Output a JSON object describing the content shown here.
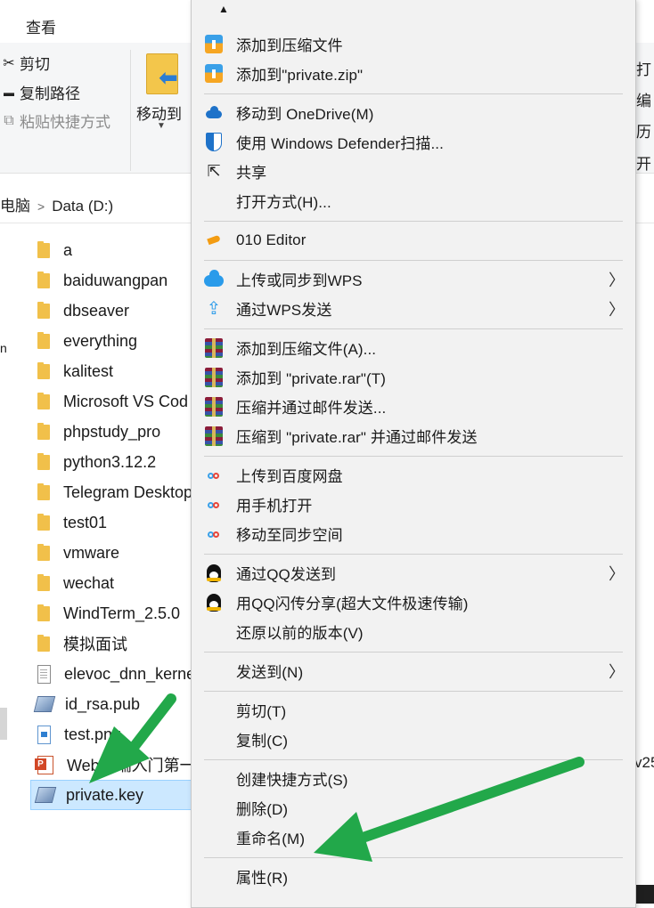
{
  "ribbon": {
    "tab_view": "查看",
    "cut": "剪切",
    "copy_path": "复制路径",
    "paste_shortcut": "粘贴快捷方式",
    "move_to": "移动到",
    "right_fragments": [
      "打",
      "编",
      "历",
      "开"
    ]
  },
  "address": {
    "crumb1": "电脑",
    "crumb2": "Data (D:)"
  },
  "files": [
    {
      "name": "a",
      "type": "folder"
    },
    {
      "name": "baiduwangpan",
      "type": "folder"
    },
    {
      "name": "dbseaver",
      "type": "folder"
    },
    {
      "name": "everything",
      "type": "folder"
    },
    {
      "name": "kalitest",
      "type": "folder"
    },
    {
      "name": "Microsoft VS Cod",
      "type": "folder"
    },
    {
      "name": "phpstudy_pro",
      "type": "folder"
    },
    {
      "name": "python3.12.2",
      "type": "folder"
    },
    {
      "name": "Telegram Desktop",
      "type": "folder"
    },
    {
      "name": "test01",
      "type": "folder"
    },
    {
      "name": "vmware",
      "type": "folder"
    },
    {
      "name": "wechat",
      "type": "folder"
    },
    {
      "name": "WindTerm_2.5.0",
      "type": "folder"
    },
    {
      "name": "模拟面试",
      "type": "folder"
    },
    {
      "name": "elevoc_dnn_kerne",
      "type": "doc"
    },
    {
      "name": "id_rsa.pub",
      "type": "key"
    },
    {
      "name": "test.png",
      "type": "png"
    },
    {
      "name": "Web前端入门第一",
      "type": "ppt"
    },
    {
      "name": "private.key",
      "type": "key",
      "selected": true
    }
  ],
  "fragments": {
    "right_v25": "v25",
    "nav_left": "n"
  },
  "menu": {
    "add_to_archive": "添加到压缩文件",
    "add_to_zip": "添加到\"private.zip\"",
    "move_onedrive": "移动到 OneDrive(M)",
    "defender_scan": "使用 Windows Defender扫描...",
    "share": "共享",
    "open_with": "打开方式(H)...",
    "editor_010": "010 Editor",
    "upload_wps": "上传或同步到WPS",
    "send_wps": "通过WPS发送",
    "rar_add_archive": "添加到压缩文件(A)...",
    "rar_add_private": "添加到 \"private.rar\"(T)",
    "rar_compress_email": "压缩并通过邮件发送...",
    "rar_compress_private_email": "压缩到 \"private.rar\" 并通过邮件发送",
    "baidu_upload": "上传到百度网盘",
    "baidu_phone": "用手机打开",
    "baidu_sync": "移动至同步空间",
    "qq_send": "通过QQ发送到",
    "qq_flash": "用QQ闪传分享(超大文件极速传输)",
    "restore_versions": "还原以前的版本(V)",
    "send_to": "发送到(N)",
    "cut": "剪切(T)",
    "copy": "复制(C)",
    "create_shortcut": "创建快捷方式(S)",
    "delete": "删除(D)",
    "rename": "重命名(M)",
    "properties": "属性(R)"
  },
  "colors": {
    "menu_bg": "#f2f2f2",
    "selection": "#cce8ff",
    "arrow_green": "#22a84a"
  }
}
